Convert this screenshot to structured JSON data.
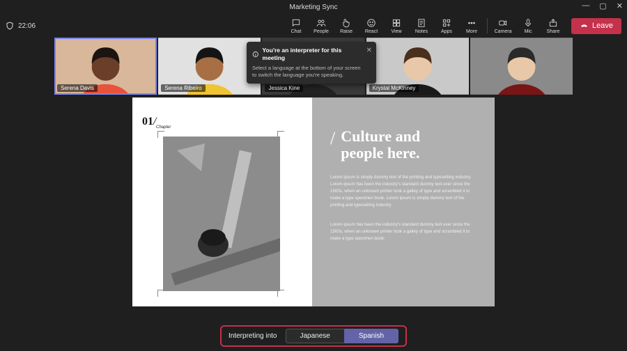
{
  "window": {
    "title": "Marketing Sync"
  },
  "win_ctrls": {
    "min": "—",
    "max": "▢",
    "close": "✕"
  },
  "timer": "22:06",
  "toolbar": {
    "chat": "Chat",
    "people": "People",
    "raise": "Raise",
    "react": "React",
    "view": "View",
    "notes": "Notes",
    "apps": "Apps",
    "more": "More",
    "camera": "Camera",
    "mic": "Mic",
    "share": "Share",
    "leave": "Leave"
  },
  "participants": [
    {
      "name": "Serena Davis",
      "bg": "#d8b79a",
      "shirt": "#e7533a",
      "skin": "#6b3e2a",
      "hair": "#1b1410",
      "active": true
    },
    {
      "name": "Serena Ribeiro",
      "bg": "#e1e1e1",
      "shirt": "#f0c330",
      "skin": "#a86f44",
      "hair": "#141414",
      "active": false
    },
    {
      "name": "Jessica Kine",
      "bg": "#3a3a3a",
      "shirt": "#222222",
      "skin": "#e8c49e",
      "hair": "#2a1b12",
      "active": false
    },
    {
      "name": "Krystal McKinney",
      "bg": "#c9c9c9",
      "shirt": "#1a1a1a",
      "skin": "#e8c8a8",
      "hair": "#4a2f1d",
      "active": false
    },
    {
      "name": "",
      "bg": "#8a8a8a",
      "shirt": "#7a1515",
      "skin": "#e8c8a8",
      "hair": "#2a2a2a",
      "active": false
    }
  ],
  "tooltip": {
    "title": "You're an interpreter for this meeting",
    "body": "Select a language at the bottom of your screen to switch the language you're speaking."
  },
  "doc": {
    "chapter_num": "01",
    "chapter_label": "Chapter",
    "heading_l1": "Culture and",
    "heading_l2": "people here.",
    "p1": "Lorem ipsum is simply dummy text of the printing and typesetting industry. Lorem ipsum has been the industry's standard dummy text ever since the 1500s, when an unknown printer took a galley of type and scrambled it to make a type specimen book. Lorem ipsum is simply dummy text of the printing and typesetting industry.",
    "p2": "Lorem ipsum has been the industry's standard dummy text ever since the 1500s, when an unknown printer took a galley of type and scrambled it to make a type specimen book."
  },
  "interpreter": {
    "label": "Interpreting into",
    "options": [
      {
        "label": "Japanese",
        "selected": false
      },
      {
        "label": "Spanish",
        "selected": true
      }
    ]
  }
}
